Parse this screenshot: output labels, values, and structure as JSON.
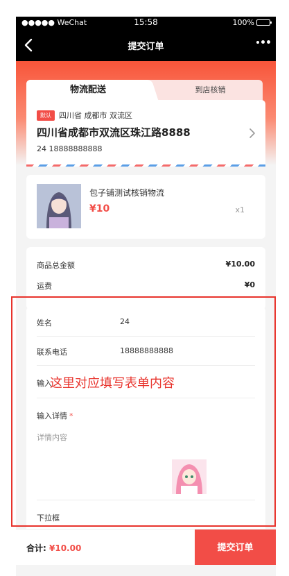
{
  "status_bar": {
    "carrier": "●●●●● WeChat",
    "time": "15:58",
    "battery": "100%"
  },
  "nav": {
    "title": "提交订单",
    "back_icon": "chevron-left-icon",
    "more_icon": "more-dots-icon"
  },
  "tabs": {
    "active": "物流配送",
    "inactive": "到店核销"
  },
  "address": {
    "badge": "默认",
    "region": "四川省 成都市 双流区",
    "street": "四川省成都市双流区珠江路8888",
    "contact": "24 18888888888"
  },
  "product": {
    "name": "包子铺测试核销物流",
    "price": "¥10",
    "qty": "x1"
  },
  "totals": {
    "goods_label": "商品总金额",
    "goods_value": "¥10.00",
    "shipping_label": "运费",
    "shipping_value": "¥0"
  },
  "form": {
    "name_label": "姓名",
    "name_value": "24",
    "phone_label": "联系电话",
    "phone_value": "18888888888",
    "input_label": "输入",
    "detail_label": "输入详情",
    "required_mark": "*",
    "detail_placeholder": "详情内容",
    "dropdown_label": "下拉框"
  },
  "annotation": {
    "text": "这里对应填写表单内容",
    "color": "#e8332c"
  },
  "bottom": {
    "total_label": "合计:",
    "total_amount": "¥10.00",
    "submit_label": "提交订单"
  },
  "colors": {
    "accent": "#f24d47",
    "header_gradient_top": "#f8553a"
  }
}
